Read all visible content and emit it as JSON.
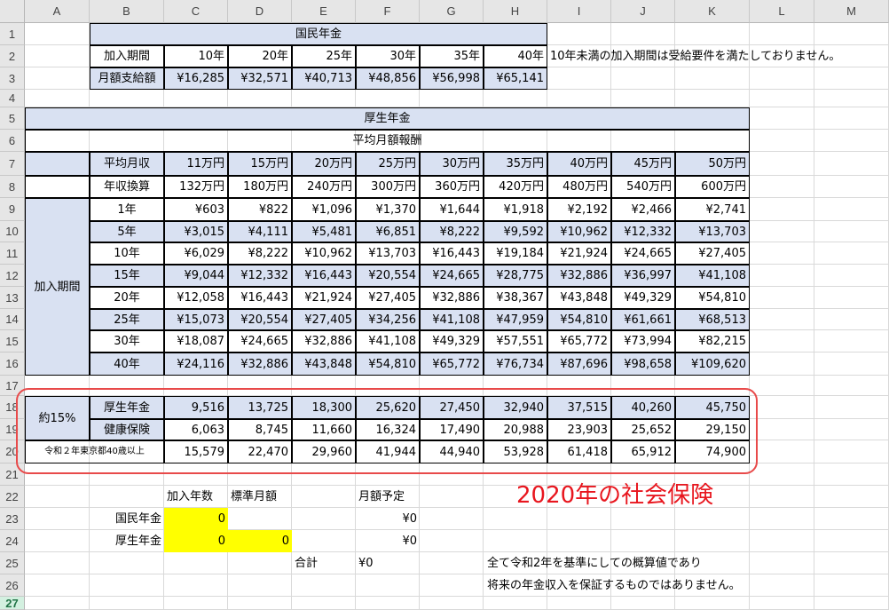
{
  "columns": [
    "A",
    "B",
    "C",
    "D",
    "E",
    "F",
    "G",
    "H",
    "I",
    "J",
    "K",
    "L",
    "M"
  ],
  "rows": [
    "1",
    "2",
    "3",
    "4",
    "5",
    "6",
    "7",
    "8",
    "9",
    "10",
    "11",
    "12",
    "13",
    "14",
    "15",
    "16",
    "17",
    "18",
    "19",
    "20",
    "21",
    "22",
    "23",
    "24",
    "25",
    "26",
    "27"
  ],
  "national": {
    "title": "国民年金",
    "period_label": "加入期間",
    "periods": [
      "10年",
      "20年",
      "25年",
      "30年",
      "35年",
      "40年"
    ],
    "monthly_label": "月額支給額",
    "monthly": [
      "¥16,285",
      "¥32,571",
      "¥40,713",
      "¥48,856",
      "¥56,998",
      "¥65,141"
    ],
    "note": "10年未満の加入期間は受給要件を満たしておりません。"
  },
  "welfare": {
    "title": "厚生年金",
    "subtitle": "平均月額報酬",
    "avg_label": "平均月収",
    "avg": [
      "11万円",
      "15万円",
      "20万円",
      "25万円",
      "30万円",
      "35万円",
      "40万円",
      "45万円",
      "50万円"
    ],
    "annual_label": "年収換算",
    "annual": [
      "132万円",
      "180万円",
      "240万円",
      "300万円",
      "360万円",
      "420万円",
      "480万円",
      "540万円",
      "600万円"
    ],
    "period_group": "加入期間",
    "rows": [
      {
        "label": "1年",
        "values": [
          "¥603",
          "¥822",
          "¥1,096",
          "¥1,370",
          "¥1,644",
          "¥1,918",
          "¥2,192",
          "¥2,466",
          "¥2,741"
        ]
      },
      {
        "label": "5年",
        "values": [
          "¥3,015",
          "¥4,111",
          "¥5,481",
          "¥6,851",
          "¥8,222",
          "¥9,592",
          "¥10,962",
          "¥12,332",
          "¥13,703"
        ]
      },
      {
        "label": "10年",
        "values": [
          "¥6,029",
          "¥8,222",
          "¥10,962",
          "¥13,703",
          "¥16,443",
          "¥19,184",
          "¥21,924",
          "¥24,665",
          "¥27,405"
        ]
      },
      {
        "label": "15年",
        "values": [
          "¥9,044",
          "¥12,332",
          "¥16,443",
          "¥20,554",
          "¥24,665",
          "¥28,775",
          "¥32,886",
          "¥36,997",
          "¥41,108"
        ]
      },
      {
        "label": "20年",
        "values": [
          "¥12,058",
          "¥16,443",
          "¥21,924",
          "¥27,405",
          "¥32,886",
          "¥38,367",
          "¥43,848",
          "¥49,329",
          "¥54,810"
        ]
      },
      {
        "label": "25年",
        "values": [
          "¥15,073",
          "¥20,554",
          "¥27,405",
          "¥34,256",
          "¥41,108",
          "¥47,959",
          "¥54,810",
          "¥61,661",
          "¥68,513"
        ]
      },
      {
        "label": "30年",
        "values": [
          "¥18,087",
          "¥24,665",
          "¥32,886",
          "¥41,108",
          "¥49,329",
          "¥57,551",
          "¥65,772",
          "¥73,994",
          "¥82,215"
        ]
      },
      {
        "label": "40年",
        "values": [
          "¥24,116",
          "¥32,886",
          "¥43,848",
          "¥54,810",
          "¥65,772",
          "¥76,734",
          "¥87,696",
          "¥98,658",
          "¥109,620"
        ]
      }
    ]
  },
  "insurance": {
    "rate_label": "約15%",
    "rows": [
      {
        "label": "厚生年金",
        "values": [
          "9,516",
          "13,725",
          "18,300",
          "25,620",
          "27,450",
          "32,940",
          "37,515",
          "40,260",
          "45,750"
        ]
      },
      {
        "label": "健康保険",
        "values": [
          "6,063",
          "8,745",
          "11,660",
          "16,324",
          "17,490",
          "20,988",
          "23,903",
          "25,652",
          "29,150"
        ]
      }
    ],
    "total_label": "令和２年東京都40歳以上",
    "total": [
      "15,579",
      "22,470",
      "29,960",
      "41,944",
      "44,940",
      "53,928",
      "61,418",
      "65,912",
      "74,900"
    ],
    "annotation": "2020年の社会保険"
  },
  "calc": {
    "years_header": "加入年数",
    "std_header": "標準月額",
    "monthly_header": "月額予定",
    "national_label": "国民年金",
    "national_years": "0",
    "national_monthly": "¥0",
    "welfare_label": "厚生年金",
    "welfare_years": "0",
    "welfare_std": "0",
    "welfare_monthly": "¥0",
    "total_label": "合計",
    "total_value": "¥0",
    "note1": "全て令和2年を基準にしての概算値であり",
    "note2": "将来の年金収入を保証するものではありません。"
  },
  "colors": {
    "header_fill": "#d9e1f2",
    "input_fill": "#ffff00",
    "annotation": "#e8161e"
  }
}
